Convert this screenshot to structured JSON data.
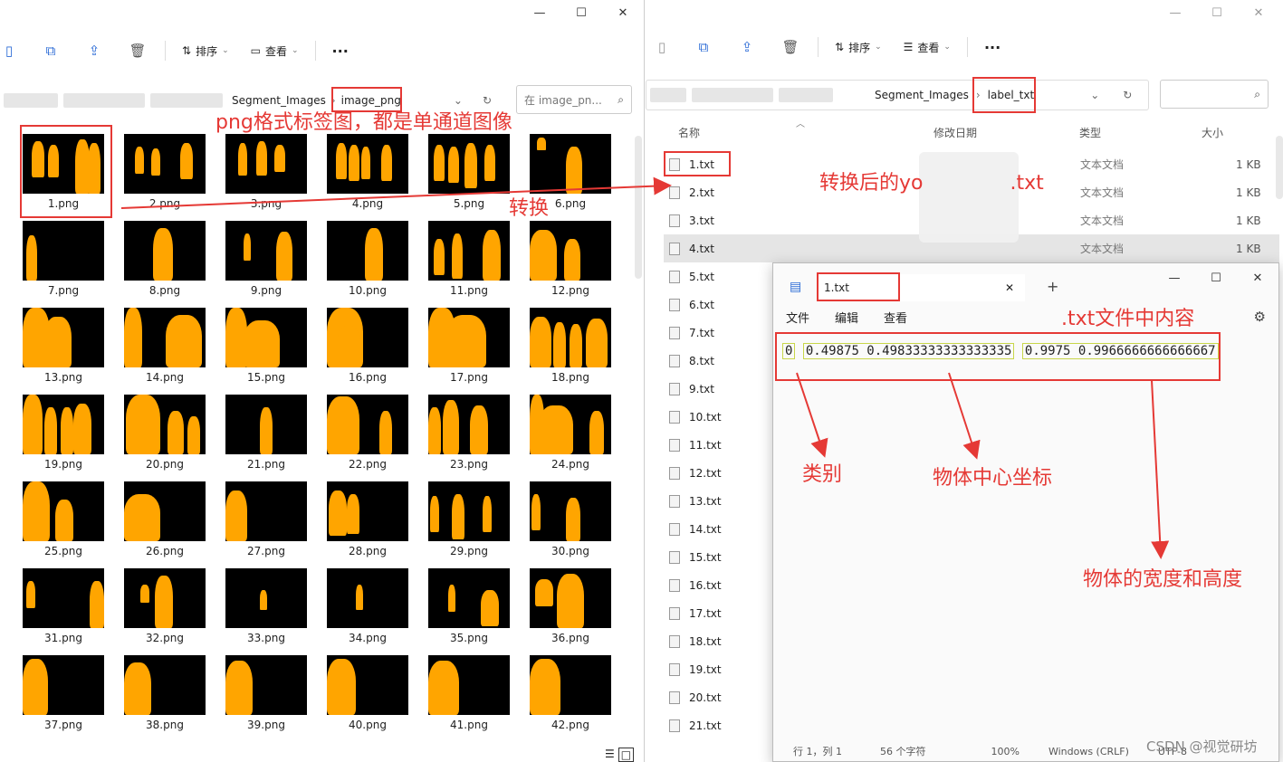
{
  "left_window": {
    "title_buttons": [
      "—",
      "☐",
      "✕"
    ],
    "toolbar": {
      "sort_label": "排序",
      "view_label": "查看",
      "more": "···"
    },
    "breadcrumb": {
      "folder1": "Segment_Images",
      "sep": "›",
      "folder2": "image_png"
    },
    "search_placeholder": "在 image_pn...",
    "thumbnails": [
      "1.png",
      "2.png",
      "3.png",
      "4.png",
      "5.png",
      "6.png",
      "7.png",
      "8.png",
      "9.png",
      "10.png",
      "11.png",
      "12.png",
      "13.png",
      "14.png",
      "15.png",
      "16.png",
      "17.png",
      "18.png",
      "19.png",
      "20.png",
      "21.png",
      "22.png",
      "23.png",
      "24.png",
      "25.png",
      "26.png",
      "27.png",
      "28.png",
      "29.png",
      "30.png",
      "31.png",
      "32.png",
      "33.png",
      "34.png",
      "35.png",
      "36.png",
      "37.png",
      "38.png",
      "39.png",
      "40.png",
      "41.png",
      "42.png"
    ]
  },
  "right_window": {
    "title_buttons": [
      "—",
      "☐",
      "✕"
    ],
    "toolbar": {
      "sort_label": "排序",
      "view_label": "查看",
      "more": "···"
    },
    "breadcrumb": {
      "folder1": "Segment_Images",
      "sep": "›",
      "folder2": "label_txt"
    },
    "columns": {
      "name": "名称",
      "modified": "修改日期",
      "type": "类型",
      "size": "大小"
    },
    "files": [
      {
        "name": "1.txt",
        "type": "文本文档",
        "size": "1 KB"
      },
      {
        "name": "2.txt",
        "type": "文本文档",
        "size": "1 KB"
      },
      {
        "name": "3.txt",
        "type": "文本文档",
        "size": "1 KB"
      },
      {
        "name": "4.txt",
        "type": "文本文档",
        "size": "1 KB"
      },
      {
        "name": "5.txt",
        "type": "",
        "size": ""
      },
      {
        "name": "6.txt",
        "type": "",
        "size": ""
      },
      {
        "name": "7.txt",
        "type": "",
        "size": ""
      },
      {
        "name": "8.txt",
        "type": "",
        "size": ""
      },
      {
        "name": "9.txt",
        "type": "",
        "size": ""
      },
      {
        "name": "10.txt",
        "type": "",
        "size": ""
      },
      {
        "name": "11.txt",
        "type": "",
        "size": ""
      },
      {
        "name": "12.txt",
        "type": "",
        "size": ""
      },
      {
        "name": "13.txt",
        "type": "",
        "size": ""
      },
      {
        "name": "14.txt",
        "type": "",
        "size": ""
      },
      {
        "name": "15.txt",
        "type": "",
        "size": ""
      },
      {
        "name": "16.txt",
        "type": "",
        "size": ""
      },
      {
        "name": "17.txt",
        "type": "",
        "size": ""
      },
      {
        "name": "18.txt",
        "type": "",
        "size": ""
      },
      {
        "name": "19.txt",
        "type": "",
        "size": ""
      },
      {
        "name": "20.txt",
        "type": "",
        "size": ""
      },
      {
        "name": "21.txt",
        "type": "",
        "size": ""
      }
    ]
  },
  "notepad": {
    "tab_title": "1.txt",
    "tab_close": "✕",
    "tab_add": "+",
    "menu": [
      "文件",
      "编辑",
      "查看"
    ],
    "content": {
      "class_id": "0",
      "center": "0.49875 0.49833333333333335",
      "size": "0.9975 0.9966666666666667"
    },
    "status": [
      "行 1，列 1",
      "56 个字符",
      "100%",
      "Windows (CRLF)",
      "UTF-8"
    ]
  },
  "annotations": {
    "png_note": "png格式标签图，都是单通道图像",
    "convert": "转换",
    "converted_note": "转换后的yo",
    "converted_suffix": ".txt",
    "content_note": ".txt文件中内容",
    "category": "类别",
    "center": "物体中心坐标",
    "wh": "物体的宽度和高度"
  },
  "watermark": "CSDN @视觉研坊",
  "colors": {
    "annotation_red": "#e53935",
    "figure_orange": "#ffa500",
    "accent_blue": "#2b6bd6"
  }
}
